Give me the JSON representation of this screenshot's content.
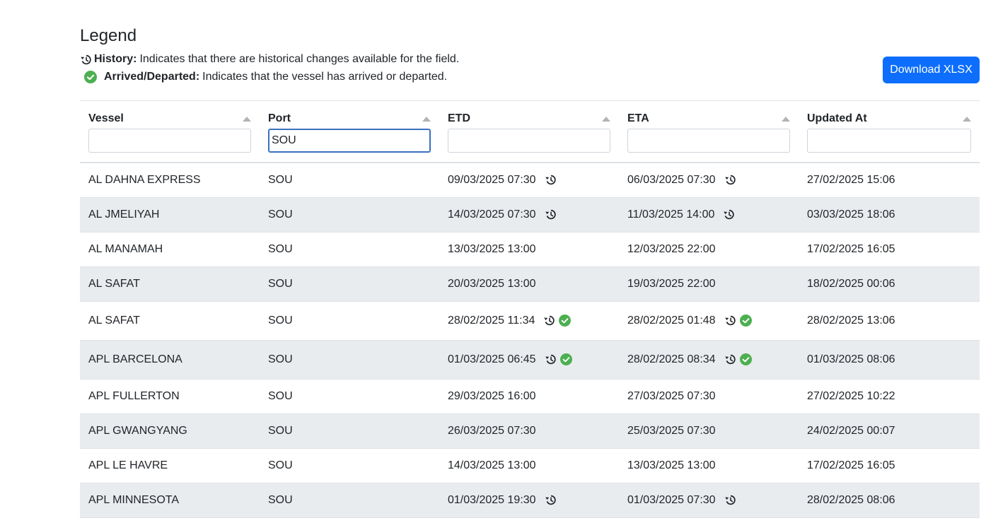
{
  "legend": {
    "title": "Legend",
    "history_label": "History:",
    "history_text": "Indicates that there are historical changes available for the field.",
    "arrived_label": "Arrived/Departed:",
    "arrived_text": "Indicates that the vessel has arrived or departed."
  },
  "toolbar": {
    "download_label": "Download XLSX"
  },
  "columns": [
    {
      "label": "Vessel",
      "filter_value": ""
    },
    {
      "label": "Port",
      "filter_value": "SOU"
    },
    {
      "label": "ETD",
      "filter_value": ""
    },
    {
      "label": "ETA",
      "filter_value": ""
    },
    {
      "label": "Updated At",
      "filter_value": ""
    }
  ],
  "icons": {
    "history": "history-icon",
    "arrived": "check-circle-icon"
  },
  "colors": {
    "accent": "#0d6efd",
    "success": "#4caf50",
    "stripe": "#e9ecef"
  },
  "rows": [
    {
      "vessel": "AL DAHNA EXPRESS",
      "port": "SOU",
      "etd": "09/03/2025 07:30",
      "etd_history": true,
      "etd_done": false,
      "eta": "06/03/2025 07:30",
      "eta_history": true,
      "eta_done": false,
      "updated": "27/02/2025 15:06"
    },
    {
      "vessel": "AL JMELIYAH",
      "port": "SOU",
      "etd": "14/03/2025 07:30",
      "etd_history": true,
      "etd_done": false,
      "eta": "11/03/2025 14:00",
      "eta_history": true,
      "eta_done": false,
      "updated": "03/03/2025 18:06"
    },
    {
      "vessel": "AL MANAMAH",
      "port": "SOU",
      "etd": "13/03/2025 13:00",
      "etd_history": false,
      "etd_done": false,
      "eta": "12/03/2025 22:00",
      "eta_history": false,
      "eta_done": false,
      "updated": "17/02/2025 16:05"
    },
    {
      "vessel": "AL SAFAT",
      "port": "SOU",
      "etd": "20/03/2025 13:00",
      "etd_history": false,
      "etd_done": false,
      "eta": "19/03/2025 22:00",
      "eta_history": false,
      "eta_done": false,
      "updated": "18/02/2025 00:06"
    },
    {
      "vessel": "AL SAFAT",
      "port": "SOU",
      "etd": "28/02/2025 11:34",
      "etd_history": true,
      "etd_done": true,
      "eta": "28/02/2025 01:48",
      "eta_history": true,
      "eta_done": true,
      "updated": "28/02/2025 13:06"
    },
    {
      "vessel": "APL BARCELONA",
      "port": "SOU",
      "etd": "01/03/2025 06:45",
      "etd_history": true,
      "etd_done": true,
      "eta": "28/02/2025 08:34",
      "eta_history": true,
      "eta_done": true,
      "updated": "01/03/2025 08:06"
    },
    {
      "vessel": "APL FULLERTON",
      "port": "SOU",
      "etd": "29/03/2025 16:00",
      "etd_history": false,
      "etd_done": false,
      "eta": "27/03/2025 07:30",
      "eta_history": false,
      "eta_done": false,
      "updated": "27/02/2025 10:22"
    },
    {
      "vessel": "APL GWANGYANG",
      "port": "SOU",
      "etd": "26/03/2025 07:30",
      "etd_history": false,
      "etd_done": false,
      "eta": "25/03/2025 07:30",
      "eta_history": false,
      "eta_done": false,
      "updated": "24/02/2025 00:07"
    },
    {
      "vessel": "APL LE HAVRE",
      "port": "SOU",
      "etd": "14/03/2025 13:00",
      "etd_history": false,
      "etd_done": false,
      "eta": "13/03/2025 13:00",
      "eta_history": false,
      "eta_done": false,
      "updated": "17/02/2025 16:05"
    },
    {
      "vessel": "APL MINNESOTA",
      "port": "SOU",
      "etd": "01/03/2025 19:30",
      "etd_history": true,
      "etd_done": false,
      "eta": "01/03/2025 07:30",
      "eta_history": true,
      "eta_done": false,
      "updated": "28/02/2025 08:06"
    }
  ]
}
